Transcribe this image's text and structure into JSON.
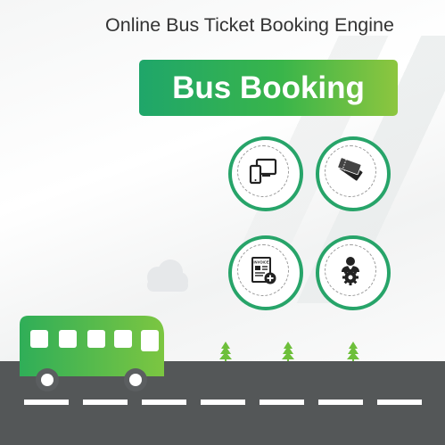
{
  "header": {
    "title": "Online Bus Ticket Booking Engine"
  },
  "banner": {
    "label": "Bus Booking"
  },
  "colors": {
    "brand_green": "#27a469",
    "banner_gradient_start": "#1fa66a",
    "banner_gradient_end": "#8dc63f",
    "road": "#545758",
    "bus_green": "#39b54a"
  },
  "features": [
    {
      "icon": "devices-icon"
    },
    {
      "icon": "tickets-icon"
    },
    {
      "icon": "invoice-icon"
    },
    {
      "icon": "agent-settings-icon"
    }
  ],
  "invoice_icon_text": "INVOICE"
}
